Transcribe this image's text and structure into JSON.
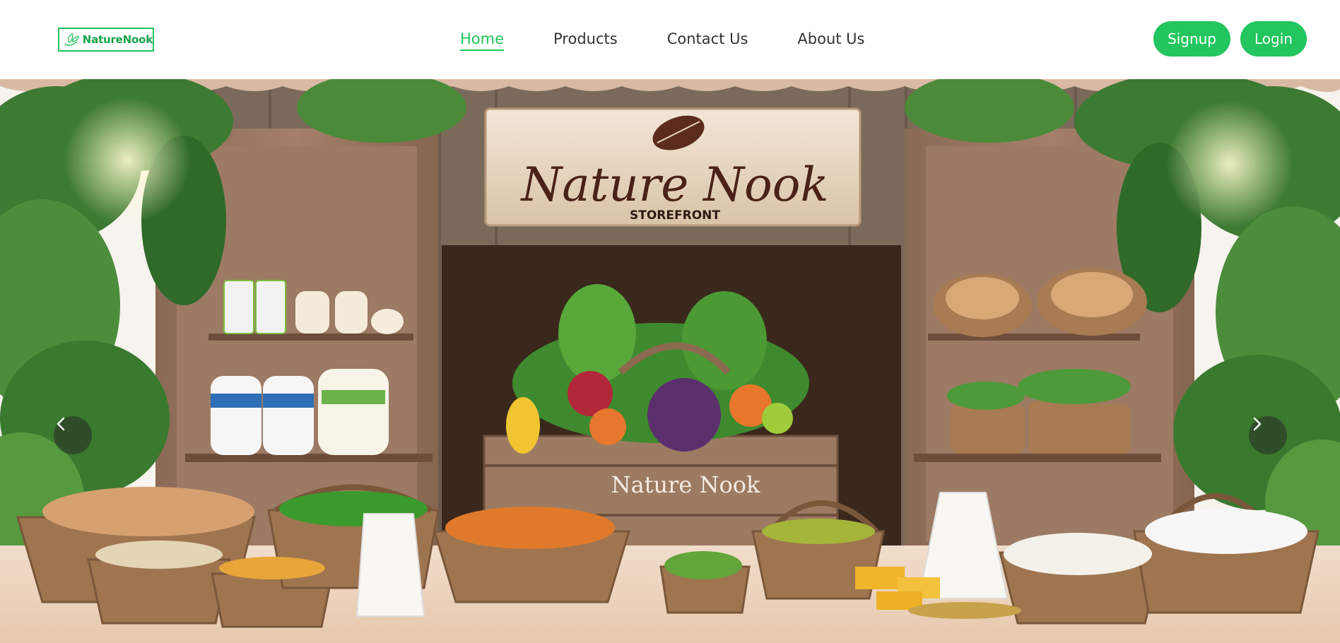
{
  "brand": {
    "name": "NatureNook",
    "color": "#22c55e"
  },
  "nav": {
    "items": [
      {
        "label": "Home",
        "active": true
      },
      {
        "label": "Products",
        "active": false
      },
      {
        "label": "Contact Us",
        "active": false
      },
      {
        "label": "About Us",
        "active": false
      }
    ]
  },
  "auth": {
    "signup_label": "Signup",
    "login_label": "Login"
  },
  "hero": {
    "sign_title": "Nature Nook",
    "sign_subtitle": "STOREFRONT",
    "crate_label": "Nature Nook",
    "prev_icon": "chevron-left-icon",
    "next_icon": "chevron-right-icon"
  }
}
